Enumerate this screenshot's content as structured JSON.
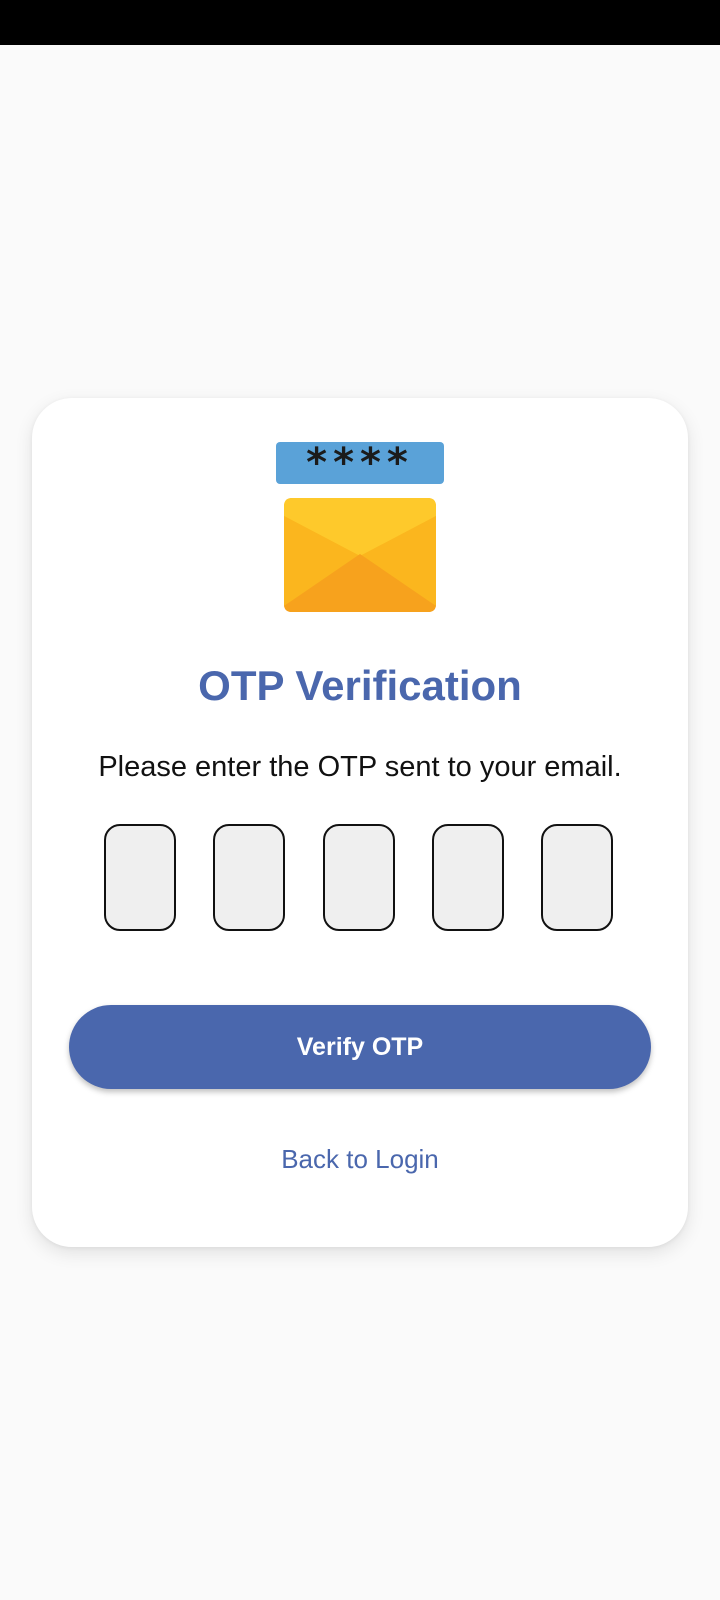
{
  "screen": {
    "title": "OTP Verification",
    "subtitle": "Please enter the OTP sent to your email.",
    "illustration_icon": "email-otp-icon",
    "masked_code": "****"
  },
  "otp": {
    "fields": [
      {
        "value": ""
      },
      {
        "value": ""
      },
      {
        "value": ""
      },
      {
        "value": ""
      },
      {
        "value": ""
      }
    ]
  },
  "actions": {
    "verify_label": "Verify OTP",
    "back_label": "Back to Login"
  },
  "colors": {
    "primary": "#4a67ad",
    "status_bar": "#000000",
    "background": "#fafafa",
    "card": "#ffffff",
    "otp_field_fill": "#efefef",
    "envelope": "#fbb61e",
    "code_badge": "#5aa2d8"
  }
}
